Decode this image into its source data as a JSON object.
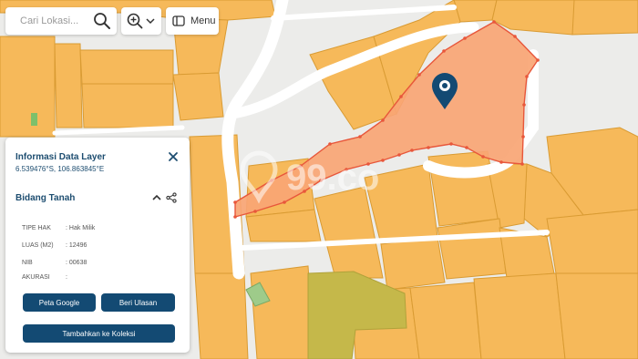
{
  "search": {
    "placeholder": "Cari Lokasi..."
  },
  "toolbar": {
    "menu_label": "Menu"
  },
  "watermark": {
    "text": "99.co"
  },
  "info_panel": {
    "title": "Informasi Data Layer",
    "coordinates": "6.539476°S, 106.863845°E",
    "section_title": "Bidang Tanah",
    "rows": [
      {
        "label": "TIPE HAK",
        "value": ": Hak Milik"
      },
      {
        "label": "LUAS (M2)",
        "value": ": 12496"
      },
      {
        "label": "NIB",
        "value": ": 00638"
      },
      {
        "label": "AKURASI",
        "value": ":"
      }
    ],
    "buttons": {
      "google": "Peta Google",
      "review": "Beri Ulasan",
      "collection": "Tambahkan ke Koleksi"
    }
  },
  "colors": {
    "parcel": "#f6b95a",
    "parcel_border": "#d99b33",
    "selected_parcel": "#f8a574",
    "selected_border": "#e8573b",
    "road": "#ffffff",
    "accent": "#134a73",
    "green_parcel": "#9ecb8a",
    "olive_parcel": "#c5b84a"
  },
  "icons": [
    "search-icon",
    "zoom-in-icon",
    "chevron-down-icon",
    "menu-panel-icon",
    "close-icon",
    "chevron-up-icon",
    "share-icon",
    "location-pin-icon"
  ]
}
